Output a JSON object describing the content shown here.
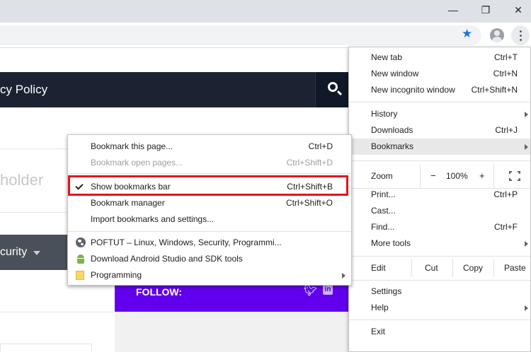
{
  "window_controls": {
    "minimize": "—",
    "restore": "❐",
    "close": "✕"
  },
  "site": {
    "nav_text": "cy Policy",
    "holder_text": "holder",
    "security_text": "curity",
    "follow_label": "FOLLOW:"
  },
  "main_menu": {
    "items": [
      {
        "label": "New tab",
        "shortcut": "Ctrl+T"
      },
      {
        "label": "New window",
        "shortcut": "Ctrl+N"
      },
      {
        "label": "New incognito window",
        "shortcut": "Ctrl+Shift+N"
      },
      {
        "label": "History",
        "shortcut": ""
      },
      {
        "label": "Downloads",
        "shortcut": "Ctrl+J"
      },
      {
        "label": "Bookmarks",
        "shortcut": ""
      },
      {
        "label": "Print...",
        "shortcut": "Ctrl+P"
      },
      {
        "label": "Cast...",
        "shortcut": ""
      },
      {
        "label": "Find...",
        "shortcut": "Ctrl+F"
      },
      {
        "label": "More tools",
        "shortcut": ""
      },
      {
        "label": "Settings",
        "shortcut": ""
      },
      {
        "label": "Help",
        "shortcut": ""
      },
      {
        "label": "Exit",
        "shortcut": ""
      }
    ],
    "zoom": {
      "label": "Zoom",
      "minus": "−",
      "value": "100%",
      "plus": "+"
    },
    "edit": {
      "label": "Edit",
      "cut": "Cut",
      "copy": "Copy",
      "paste": "Paste"
    }
  },
  "bookmarks_menu": {
    "items": [
      {
        "label": "Bookmark this page...",
        "shortcut": "Ctrl+D"
      },
      {
        "label": "Bookmark open pages...",
        "shortcut": "Ctrl+Shift+D",
        "disabled": true
      },
      {
        "label": "Show bookmarks bar",
        "shortcut": "Ctrl+Shift+B",
        "checked": true
      },
      {
        "label": "Bookmark manager",
        "shortcut": "Ctrl+Shift+O"
      },
      {
        "label": "Import bookmarks and settings...",
        "shortcut": ""
      },
      {
        "label": "POFTUT – Linux, Windows, Security, Programmi...",
        "icon": "globe-icon"
      },
      {
        "label": "Download Android Studio and SDK tools",
        "icon": "android-icon"
      },
      {
        "label": "Programming",
        "icon": "folder-icon"
      }
    ]
  },
  "colors": {
    "highlight_border": "#e3141b",
    "follow_bg": "#6200ee",
    "nav_bg": "#1b2333",
    "star": "#1a73e8"
  }
}
